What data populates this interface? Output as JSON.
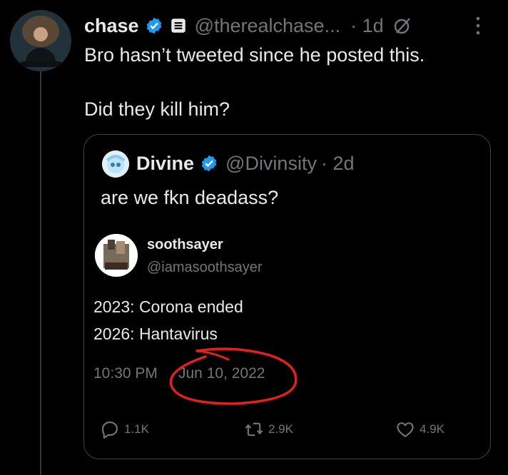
{
  "tweet": {
    "author_name": "chase",
    "handle": "@therealchase...",
    "time": "· 1d",
    "text_line1": "Bro hasn’t tweeted since he posted this.",
    "text_line2": "Did they kill him?"
  },
  "quote": {
    "author_name": "Divine",
    "handle": "@Divinsity",
    "time": "· 2d",
    "text": "are we fkn deadass?",
    "embedded": {
      "name": "soothsayer",
      "handle": "@iamasoothsayer",
      "line1": "2023: Corona ended",
      "line2": "2026: Hantavirus",
      "time": "10:30 PM",
      "date": "Jun 10, 2022"
    }
  },
  "actions": {
    "replies": "1.1K",
    "retweets": "2.9K",
    "likes": "4.9K"
  },
  "colors": {
    "background": "#000000",
    "text": "#e7e9ea",
    "muted": "#71767b",
    "verified": "#1d9bf0",
    "annotation": "#e3201b"
  },
  "icons": [
    "verified-badge-icon",
    "newsletter-icon",
    "grok-icon",
    "more-icon",
    "reply-icon",
    "retweet-icon",
    "like-icon"
  ]
}
